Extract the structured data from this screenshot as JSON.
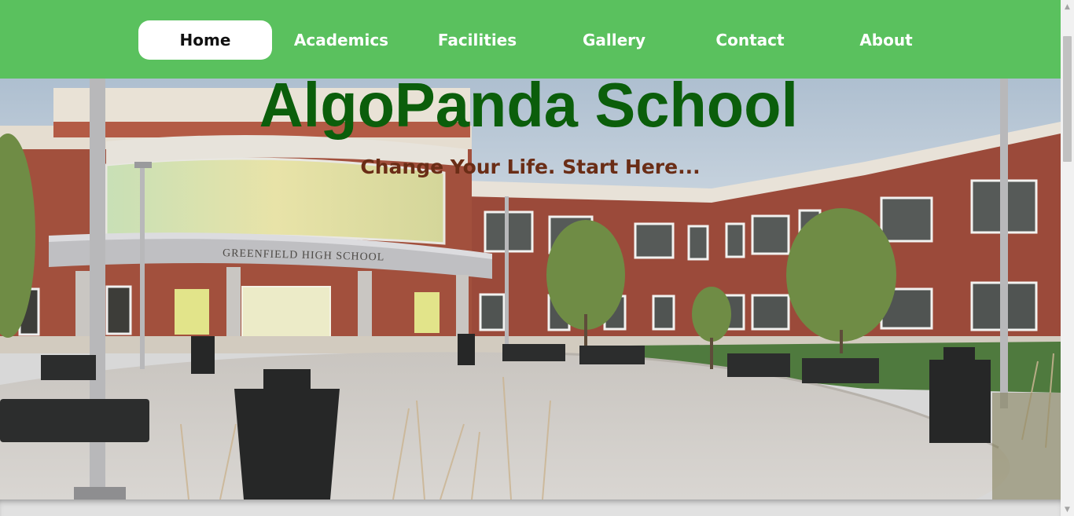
{
  "nav": {
    "items": [
      {
        "label": "Home",
        "active": true
      },
      {
        "label": "Academics",
        "active": false
      },
      {
        "label": "Facilities",
        "active": false
      },
      {
        "label": "Gallery",
        "active": false
      },
      {
        "label": "Contact",
        "active": false
      },
      {
        "label": "About",
        "active": false
      }
    ]
  },
  "hero": {
    "title": "AlgoPanda School",
    "tagline": "Change Your Life. Start Here...",
    "building_sign": "GREENFIELD HIGH SCHOOL"
  },
  "colors": {
    "navbar": "#5ac15e",
    "nav_active_bg": "#ffffff",
    "title": "#0b5e0b",
    "tagline": "#6a2d16"
  },
  "icons": {
    "scroll_up": "triangle-up",
    "scroll_down": "triangle-down"
  }
}
